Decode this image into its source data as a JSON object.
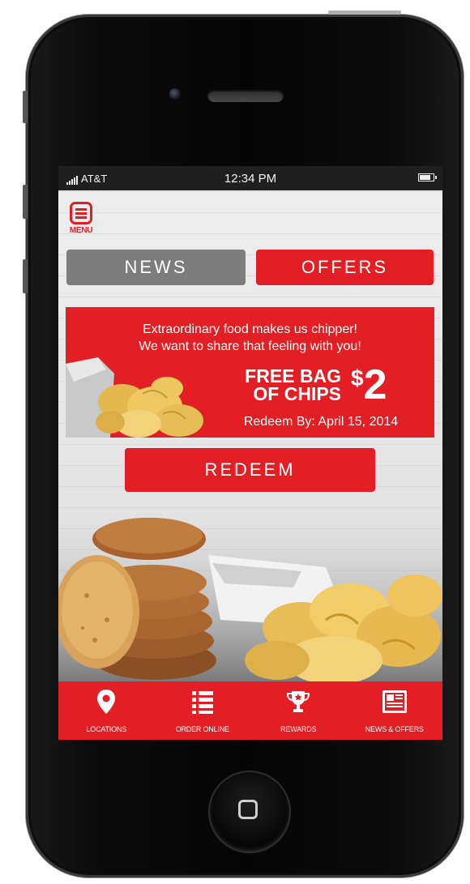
{
  "status_bar": {
    "carrier": "AT&T",
    "time": "12:34 PM"
  },
  "menu": {
    "label": "MENU",
    "icon": "hamburger-icon"
  },
  "tabs": [
    {
      "label": "NEWS",
      "active": false
    },
    {
      "label": "OFFERS",
      "active": true
    }
  ],
  "offer": {
    "tagline_line1": "Extraordinary food makes us chipper!",
    "tagline_line2": "We want to share that feeling with you!",
    "title_line1": "FREE BAG",
    "title_line2": "OF CHIPS",
    "price_symbol": "$",
    "price_value": "2",
    "redeem_by": "Redeem By: April 15, 2014"
  },
  "redeem_button": {
    "label": "REDEEM"
  },
  "bottom_nav": [
    {
      "label": "LOCATIONS",
      "icon": "map-pin-icon"
    },
    {
      "label": "ORDER ONLINE",
      "icon": "list-icon"
    },
    {
      "label": "REWARDS",
      "icon": "trophy-icon"
    },
    {
      "label": "NEWS & OFFERS",
      "icon": "newspaper-icon"
    }
  ],
  "colors": {
    "brand_red": "#e31e24",
    "news_tab_gray": "#7d7d7d",
    "status_bar": "#1f1f1f"
  }
}
